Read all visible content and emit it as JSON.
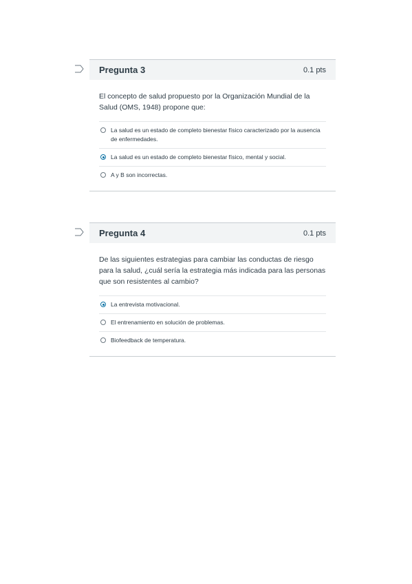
{
  "questions": [
    {
      "title": "Pregunta 3",
      "points": "0.1 pts",
      "text": "El concepto de salud propuesto por la Organización Mundial de la Salud (OMS, 1948) propone que:",
      "answers": [
        {
          "label": "La salud es un estado de completo bienestar físico caracterizado por la ausencia de enfermedades.",
          "selected": false
        },
        {
          "label": "La salud es un estado de completo bienestar físico, mental y social.",
          "selected": true
        },
        {
          "label": "A y B son incorrectas.",
          "selected": false
        }
      ]
    },
    {
      "title": "Pregunta 4",
      "points": "0.1 pts",
      "text": "De las siguientes estrategias para cambiar las conductas de riesgo para la salud, ¿cuál sería la estrategia más indicada para las personas que son resistentes al cambio?",
      "answers": [
        {
          "label": "La entrevista motivacional.",
          "selected": true
        },
        {
          "label": "El entrenamiento en solución de problemas.",
          "selected": false
        },
        {
          "label": "Biofeedback de temperatura.",
          "selected": false
        }
      ]
    }
  ],
  "colors": {
    "accent": "#0770a3",
    "header_bg": "#f2f4f5",
    "text": "#2d3b45"
  },
  "icons": {
    "flag": "bookmark-flag-icon",
    "radio": "radio-button-icon"
  }
}
